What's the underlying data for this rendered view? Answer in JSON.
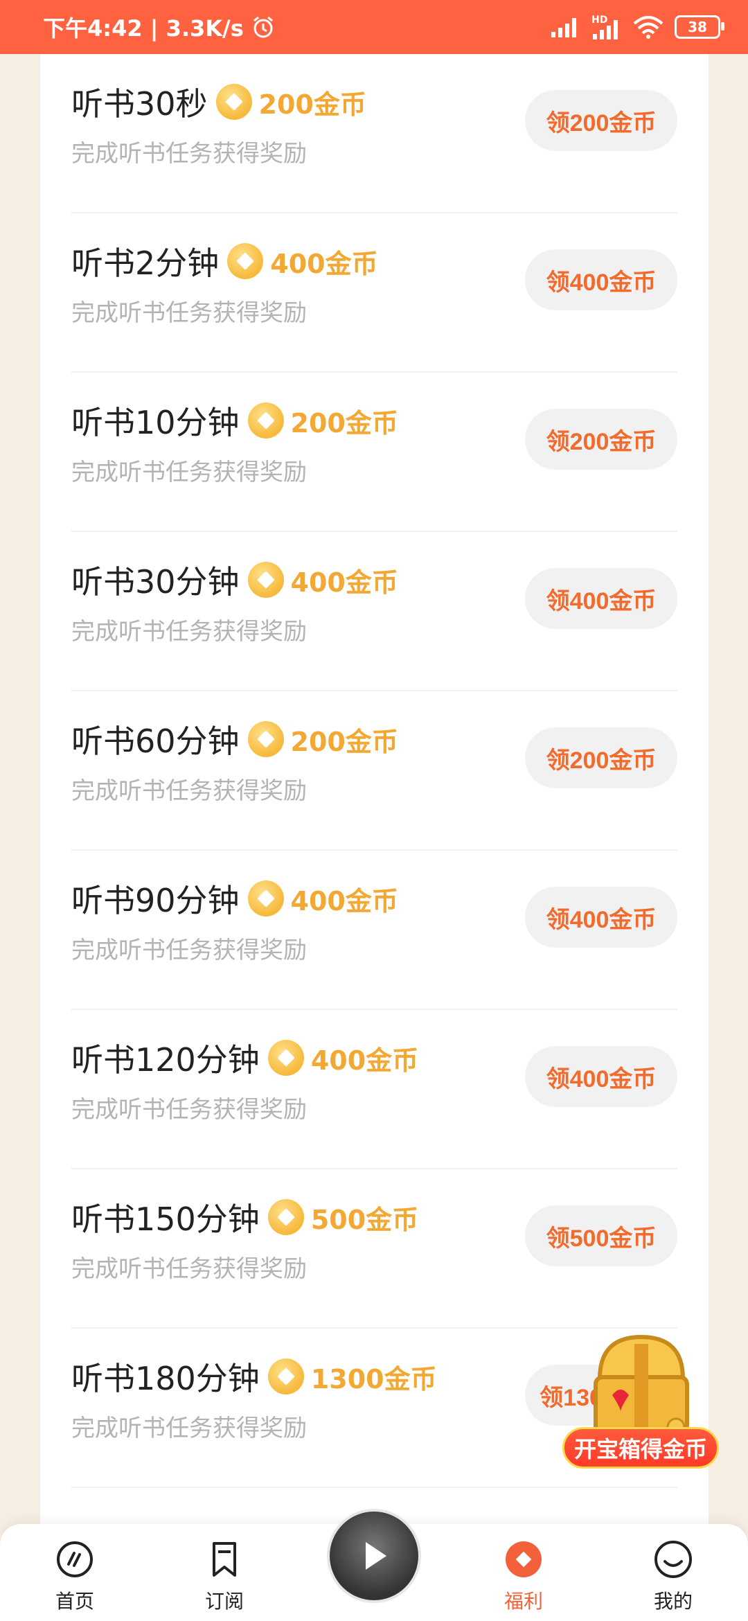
{
  "status_bar": {
    "time_speed": "下午4:42 | 3.3K/s",
    "network_label": "HD",
    "battery": "38"
  },
  "tasks": [
    {
      "title": "听书30秒",
      "reward": "200金币",
      "subtitle": "完成听书任务获得奖励",
      "button": "领200金币"
    },
    {
      "title": "听书2分钟",
      "reward": "400金币",
      "subtitle": "完成听书任务获得奖励",
      "button": "领400金币"
    },
    {
      "title": "听书10分钟",
      "reward": "200金币",
      "subtitle": "完成听书任务获得奖励",
      "button": "领200金币"
    },
    {
      "title": "听书30分钟",
      "reward": "400金币",
      "subtitle": "完成听书任务获得奖励",
      "button": "领400金币"
    },
    {
      "title": "听书60分钟",
      "reward": "200金币",
      "subtitle": "完成听书任务获得奖励",
      "button": "领200金币"
    },
    {
      "title": "听书90分钟",
      "reward": "400金币",
      "subtitle": "完成听书任务获得奖励",
      "button": "领400金币"
    },
    {
      "title": "听书120分钟",
      "reward": "400金币",
      "subtitle": "完成听书任务获得奖励",
      "button": "领400金币"
    },
    {
      "title": "听书150分钟",
      "reward": "500金币",
      "subtitle": "完成听书任务获得奖励",
      "button": "领500金币"
    },
    {
      "title": "听书180分钟",
      "reward": "1300金币",
      "subtitle": "完成听书任务获得奖励",
      "button": "领1300金币"
    }
  ],
  "floating_chest": {
    "label": "开宝箱得金币"
  },
  "bottom_nav": {
    "items": [
      {
        "label": "首页",
        "icon": "home-icon"
      },
      {
        "label": "订阅",
        "icon": "bookmark-icon"
      },
      {
        "label": "福利",
        "icon": "welfare-icon",
        "active": true
      },
      {
        "label": "我的",
        "icon": "profile-icon"
      }
    ]
  },
  "colors": {
    "accent": "#ff6241",
    "coin": "#f2a832",
    "claim_text": "#f26b2c"
  }
}
